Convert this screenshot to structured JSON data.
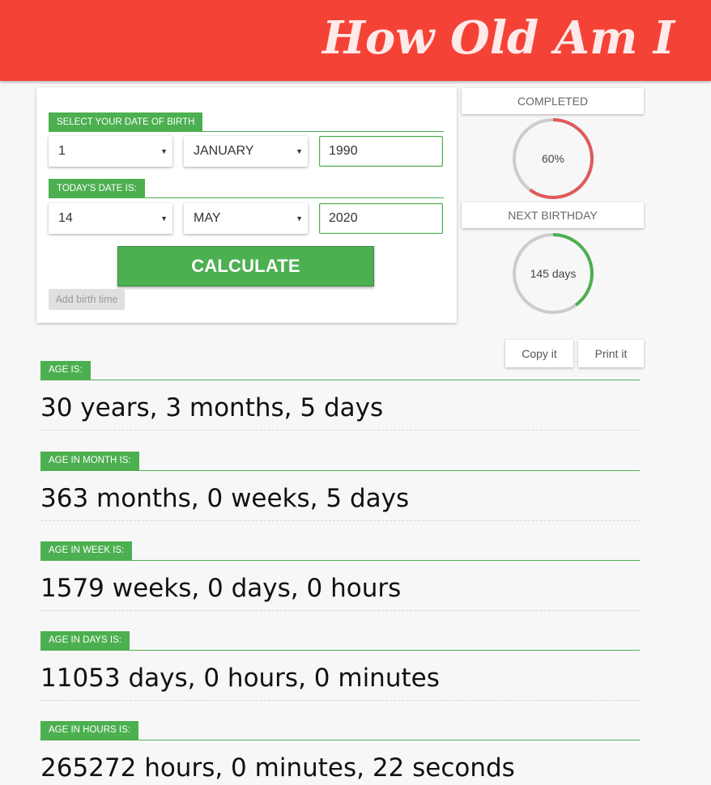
{
  "header": {
    "title": "How Old Am I"
  },
  "form": {
    "dob_label": "SELECT YOUR DATE OF BIRTH",
    "dob_day": "1",
    "dob_month": "JANUARY",
    "dob_year": "1990",
    "today_label": "TODAY'S DATE IS:",
    "today_day": "14",
    "today_month": "MAY",
    "today_year": "2020",
    "calculate_label": "CALCULATE",
    "birth_time_label": "Add birth time"
  },
  "stats": {
    "completed_label": "COMPLETED",
    "completed_value": "60%",
    "completed_fraction": 0.6,
    "completed_color": "#e05a5a",
    "next_birthday_label": "NEXT BIRTHDAY",
    "next_birthday_value": "145 days",
    "next_birthday_fraction": 0.4,
    "next_birthday_color": "#4caf50",
    "track_color": "#cccccc"
  },
  "actions": {
    "copy_label": "Copy it",
    "print_label": "Print it"
  },
  "results": [
    {
      "label": "AGE IS:",
      "value": "30 years, 3 months, 5 days"
    },
    {
      "label": "AGE IN MONTH IS:",
      "value": "363 months, 0 weeks, 5 days"
    },
    {
      "label": "AGE IN WEEK IS:",
      "value": "1579 weeks, 0 days, 0 hours"
    },
    {
      "label": "AGE IN DAYS IS:",
      "value": "11053 days, 0 hours, 0 minutes"
    },
    {
      "label": "AGE IN HOURS IS:",
      "value": "265272 hours, 0 minutes, 22 seconds"
    }
  ],
  "colors": {
    "header": "#f44336",
    "accent": "#4caf50"
  }
}
